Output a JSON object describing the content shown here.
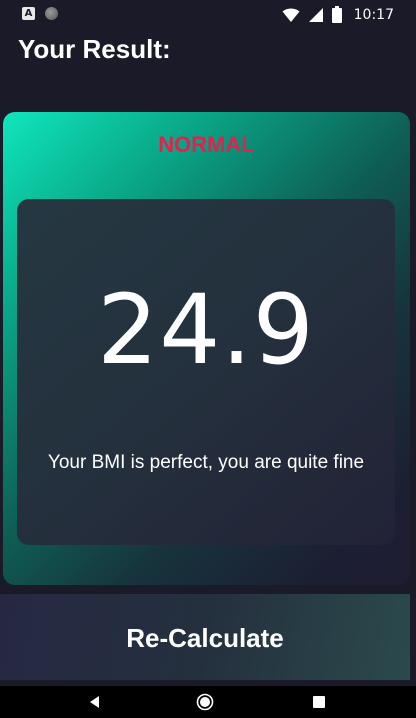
{
  "status_bar": {
    "time": "10:17",
    "icons": [
      "a-icon",
      "circle-icon",
      "wifi-icon",
      "signal-icon",
      "battery-icon"
    ]
  },
  "header": {
    "title": "Your Result:"
  },
  "result": {
    "status": "NORMAL",
    "bmi": "24.9",
    "message": "Your BMI is perfect, you are quite fine"
  },
  "actions": {
    "recalculate_label": "Re-Calculate"
  },
  "navigation": {
    "icons": [
      "back-icon",
      "home-icon",
      "recents-icon"
    ]
  },
  "colors": {
    "background": "#1b1a28",
    "accent_teal": "#10e6bc",
    "status_red": "#e91e4e",
    "text": "#ffffff"
  }
}
